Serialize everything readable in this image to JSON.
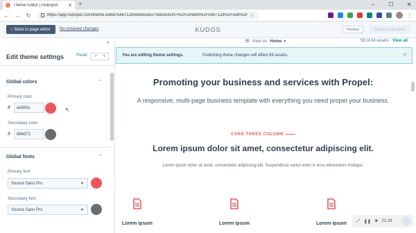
{
  "browser": {
    "tab_title": "Theme Editor | HubSpot",
    "url": "https://app.hubspot.com/theme-editor/5487128/edit/kudos?redirectUrl=%2Fcontent%2F5487128%2Fedit%2F50...",
    "new_tab": "+",
    "win_controls": [
      "–",
      "☐",
      "✕"
    ]
  },
  "hubspot_bar": {
    "back_label": "Back to page editor",
    "unsaved_label": "No unsaved changes",
    "theme_name": "KUDOS",
    "preview_label": "Preview",
    "publish_label": "Publish to all assets"
  },
  "left_panel": {
    "title": "Edit theme settings",
    "reset_label": "Reset",
    "undo_icon": "↶",
    "redo_icon": "↷",
    "collapse_icon": "«",
    "global_colors": {
      "heading": "Global colors",
      "primary_label": "Primary color",
      "primary_hex": "ee565c",
      "primary_color": "#ee565c",
      "secondary_label": "Secondary color",
      "secondary_hex": "686d72",
      "secondary_color": "#686d72"
    },
    "global_fonts": {
      "heading": "Global fonts",
      "primary_label": "Primary font",
      "primary_font": "Source Sans Pro",
      "secondary_label": "Secondary font",
      "secondary_font": "Source Sans Pro"
    }
  },
  "preview_header": {
    "view_on_label": "View on:",
    "view_on_value": "Home",
    "assets_count": "59 of 84 assets",
    "view_all": "View all"
  },
  "banner": {
    "bold_text": "You are editing theme settings.",
    "text": "Publishing these changes will affect 84 assets."
  },
  "page": {
    "headline": "Promoting your business and services with Propel:",
    "subhead": "A responsive, multi-page business template with everything you need propel your business.",
    "eyebrow": "CARD THREE COLUMN",
    "section_title": "Lorem ipsum dolor sit amet, consectetur adipiscing elit.",
    "section_text": "Lorem ipsum dolor sit amet, consectetur adipiscing elit. Suspendisse varius enim in eros elementum tristique.",
    "cards": [
      {
        "label": "Lorem ipsum"
      },
      {
        "label": "Lorem ipsum"
      },
      {
        "label": "Lorem ipsum"
      }
    ],
    "player_time": "01:29"
  },
  "colors": {
    "accent": "#ee565c",
    "brand_dark": "#425b76",
    "link": "#0091ae"
  }
}
